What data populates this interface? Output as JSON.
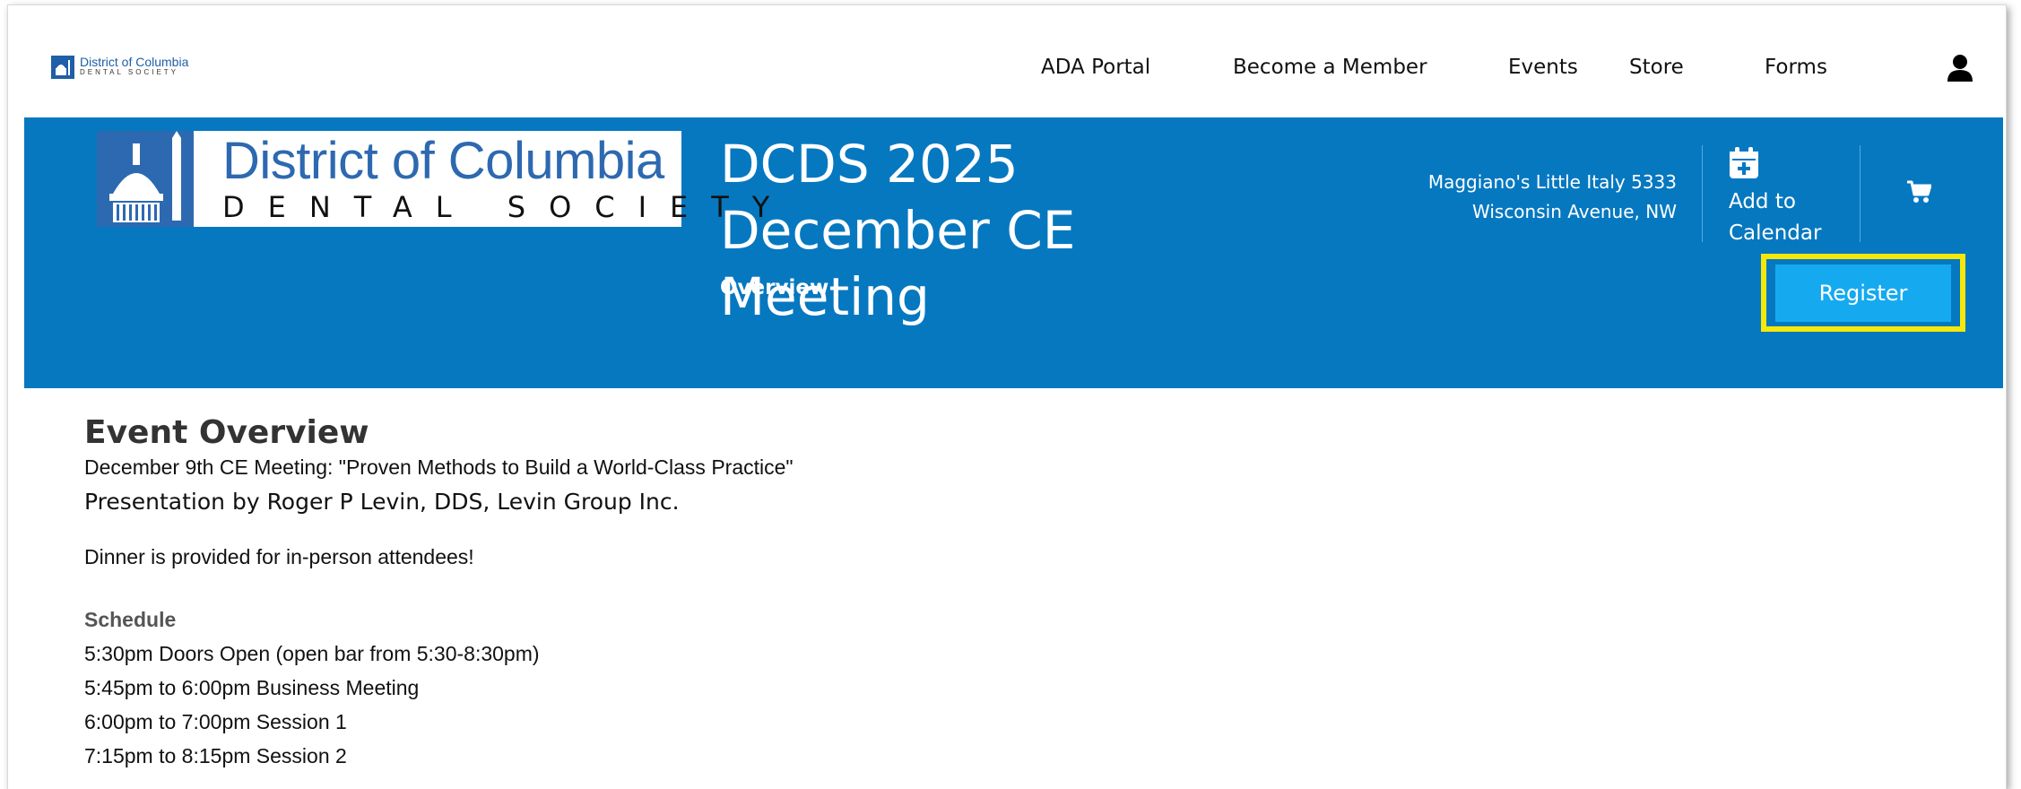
{
  "nav": {
    "logo_line1": "District of Columbia",
    "logo_line2": "DENTAL SOCIETY",
    "items": [
      {
        "label": "ADA Portal"
      },
      {
        "label": "Become a Member"
      },
      {
        "label": "Events"
      },
      {
        "label": "Store"
      },
      {
        "label": "Forms"
      }
    ],
    "user_icon": "user-icon"
  },
  "banner": {
    "logo_name": "District of Columbia",
    "logo_sub": "DENTAL SOCIETY",
    "title": "DCDS 2025 December CE Meeting",
    "tab": "Overview",
    "location_line1": "Maggiano's Little Italy 5333",
    "location_line2": "Wisconsin Avenue, NW",
    "calendar_label": "Add to Calendar",
    "calendar_icon": "calendar-plus-icon",
    "cart_icon": "cart-icon",
    "register_label": "Register",
    "colors": {
      "banner": "#0678c0",
      "register": "#15aaf0",
      "highlight": "#f7e80a"
    }
  },
  "content": {
    "heading": "Event Overview",
    "subtitle": "December 9th CE Meeting: \"Proven Methods to Build a World-Class Practice\"",
    "presenter": "Presentation by Roger P Levin, DDS, Levin Group Inc.",
    "dinner": "Dinner is provided for in-person attendees!",
    "schedule_heading": "Schedule",
    "schedule": [
      "5:30pm Doors Open (open bar from 5:30-8:30pm)",
      "5:45pm to 6:00pm Business Meeting",
      "6:00pm to 7:00pm Session 1",
      "7:15pm to 8:15pm Session 2"
    ]
  }
}
